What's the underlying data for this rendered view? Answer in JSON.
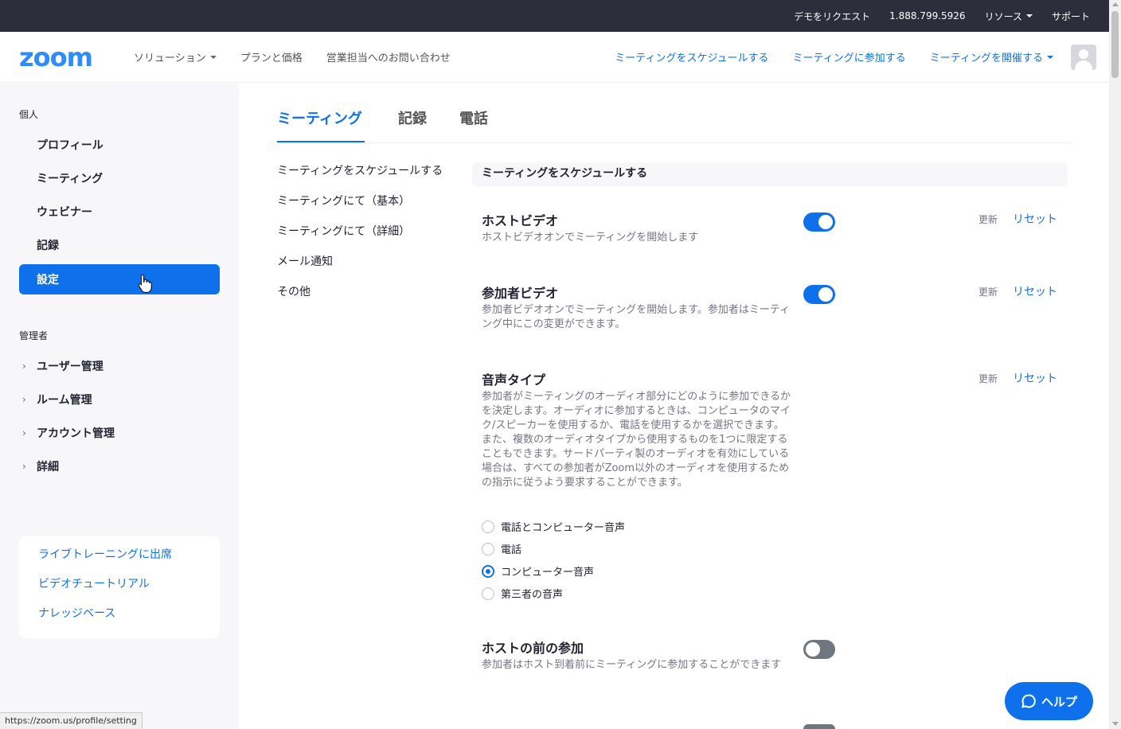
{
  "topbar": {
    "demo": "デモをリクエスト",
    "phone": "1.888.799.5926",
    "resources": "リソース",
    "support": "サポート"
  },
  "header": {
    "logo": "zoom",
    "nav_left": [
      "ソリューション",
      "プランと価格",
      "営業担当へのお問い合わせ"
    ],
    "schedule": "ミーティングをスケジュールする",
    "join": "ミーティングに参加する",
    "host": "ミーティングを開催する"
  },
  "sidebar": {
    "personal_label": "個人",
    "personal_items": [
      "プロフィール",
      "ミーティング",
      "ウェビナー",
      "記録",
      "設定"
    ],
    "admin_label": "管理者",
    "admin_items": [
      "ユーザー管理",
      "ルーム管理",
      "アカウント管理",
      "詳細"
    ],
    "help_links": [
      "ライブトレーニングに出席",
      "ビデオチュートリアル",
      "ナレッジベース"
    ]
  },
  "tabs": [
    "ミーティング",
    "記録",
    "電話"
  ],
  "subnav": [
    "ミーティングをスケジュールする",
    "ミーティングにて（基本）",
    "ミーティングにて（詳細）",
    "メール通知",
    "その他"
  ],
  "section_header": "ミーティングをスケジュールする",
  "settings": {
    "host_video": {
      "title": "ホストビデオ",
      "desc": "ホストビデオオンでミーティングを開始します",
      "enabled": true
    },
    "participant_video": {
      "title": "参加者ビデオ",
      "desc": "参加者ビデオオンでミーティングを開始します。参加者はミーティング中にこの変更ができます。",
      "enabled": true
    },
    "audio_type": {
      "title": "音声タイプ",
      "desc": "参加者がミーティングのオーディオ部分にどのように参加できるかを決定します。オーディオに参加するときは、コンピュータのマイク/スピーカーを使用するか、電話を使用するかを選択できます。また、複数のオーディオタイプから使用するものを1つに限定することもできます。サードパーティ製のオーディオを有効にしている場合は、すべての参加者がZoom以外のオーディオを使用するための指示に従うよう要求することができます。",
      "options": [
        "電話とコンピューター音声",
        "電話",
        "コンピューター音声",
        "第三者の音声"
      ],
      "selected": "コンピューター音声"
    },
    "join_before_host": {
      "title": "ホストの前の参加",
      "desc": "参加者はホスト到着前にミーティングに参加することができます",
      "enabled": false
    },
    "update_label": "更新",
    "reset_label": "リセット"
  },
  "help_button": "ヘルプ",
  "status_url": "https://zoom.us/profile/setting",
  "colors": {
    "accent": "#0e71eb",
    "topbar": "#2d2d3b",
    "sidebar_bg": "#f7f7fa"
  }
}
